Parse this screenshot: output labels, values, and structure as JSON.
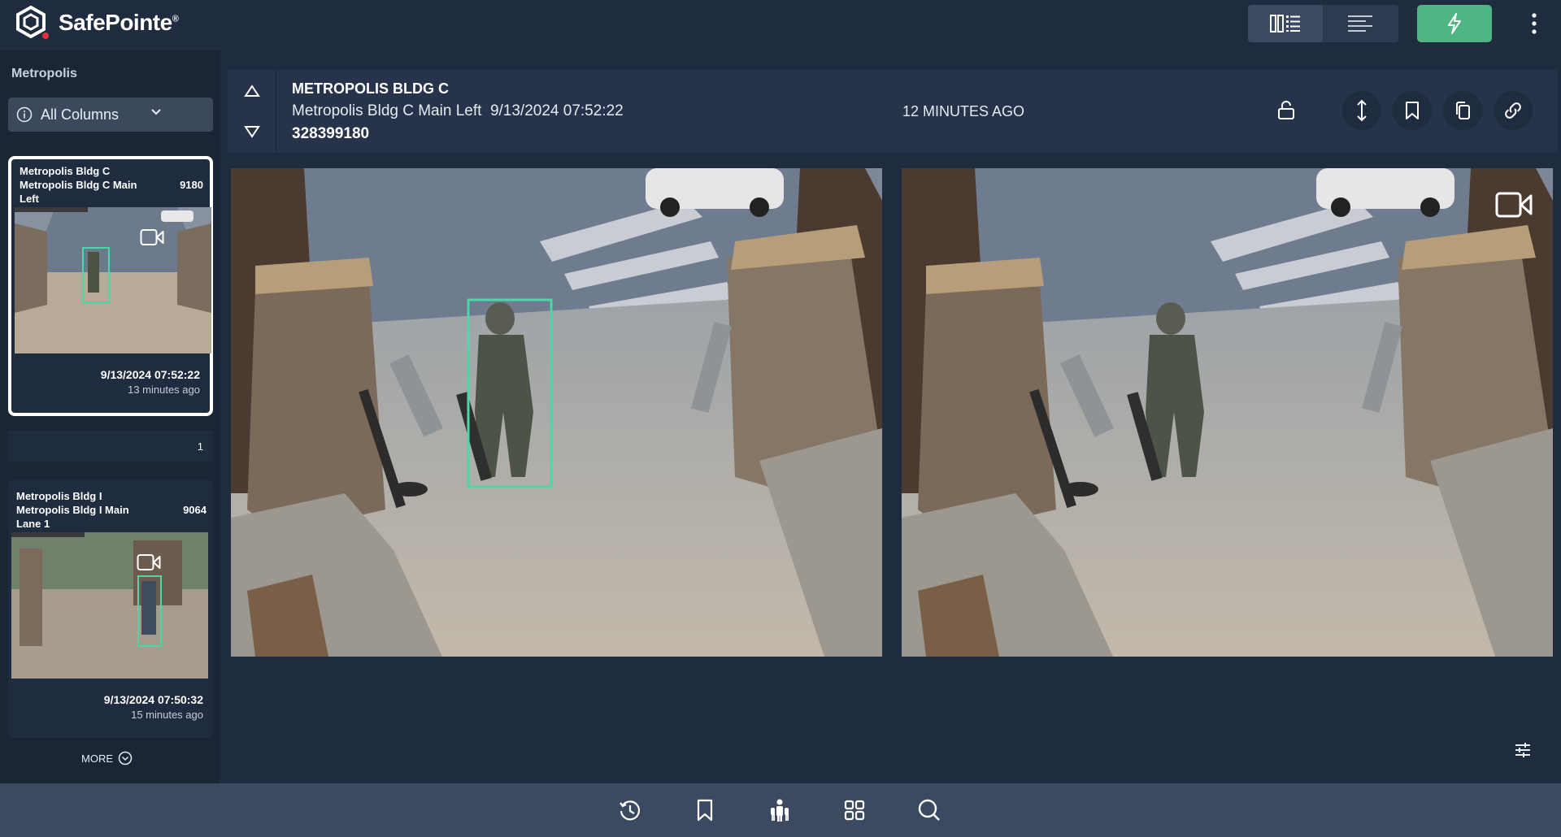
{
  "app": {
    "brand": "SafePointe",
    "reg": "®",
    "accent": "#4fb584"
  },
  "toolbar": {
    "icons": [
      "grid-list-view-icon",
      "list-view-icon",
      "lightning-icon",
      "kebab-menu-icon"
    ]
  },
  "sidebar": {
    "title": "Metropolis",
    "filter_label": "All Columns",
    "group_count": "1",
    "more_label": "MORE",
    "cards": [
      {
        "site": "Metropolis Bldg C",
        "camera": "Metropolis Bldg C Main Left",
        "count": "9180",
        "timestamp": "9/13/2024 07:52:22",
        "ago": "13 minutes ago"
      },
      {
        "site": "Metropolis Bldg I",
        "camera": "Metropolis Bldg I Main Lane 1",
        "count": "9064",
        "timestamp": "9/13/2024 07:50:32",
        "ago": "15 minutes ago"
      }
    ]
  },
  "event": {
    "title": "METROPOLIS BLDG C",
    "camera": "Metropolis Bldg C Main Left",
    "timestamp": "9/13/2024 07:52:22",
    "id": "328399180",
    "ago": "12 MINUTES AGO"
  },
  "bottom_bar": {
    "icons": [
      "history-icon",
      "bookmark-icon",
      "people-icon",
      "grid-icon",
      "search-icon"
    ]
  }
}
